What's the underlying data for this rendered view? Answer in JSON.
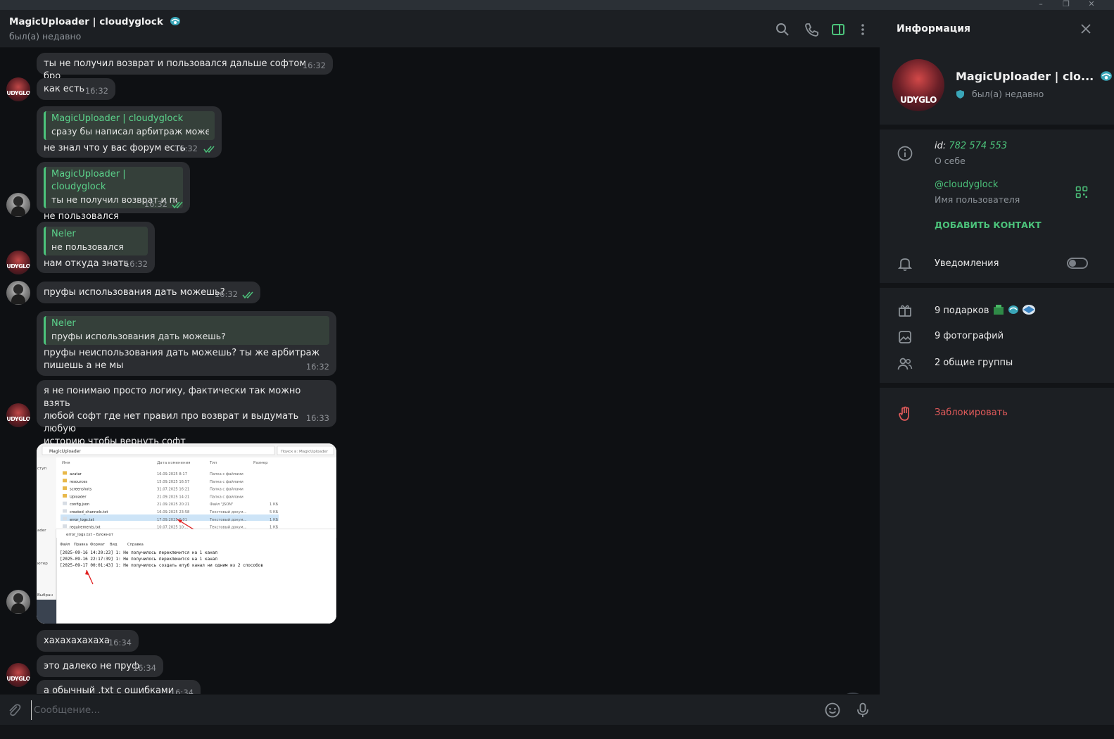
{
  "window": {
    "minimize": "–",
    "maximize": "❐",
    "close": "✕"
  },
  "chat": {
    "title": "MagicUploader | cloudyglock",
    "status": "был(а) недавно",
    "icons": [
      "search-icon",
      "phone-icon",
      "sidebar-toggle-icon",
      "more-vert-icon"
    ]
  },
  "messages": [
    {
      "text": "ты не получил возврат и пользовался дальше софтом бро",
      "time": "16:32"
    },
    {
      "text": "как есть",
      "time": "16:32"
    },
    {
      "reply_name": "MagicUploader | cloudyglock",
      "reply_text": "сразу бы написал арбитраж может...",
      "text": "не знал что у вас форум есть",
      "time": "16:32"
    },
    {
      "reply_name": "MagicUploader | cloudyglock",
      "reply_text": "ты не получил возврат и по...",
      "text": "не пользовался",
      "time": "16:32"
    },
    {
      "reply_name": "Neler",
      "reply_text": "не пользовался",
      "text": "нам откуда знать",
      "time": "16:32"
    },
    {
      "text": "пруфы использования дать можешь?",
      "time": "16:32"
    },
    {
      "reply_name": "Neler",
      "reply_text": "пруфы использования дать можешь?",
      "text_line1": "пруфы неиспользования дать можешь? ты же арбитраж",
      "text_line2": "пишешь а не мы",
      "time": "16:32"
    },
    {
      "text_line1": "я не понимаю просто логику, фактически так можно взять",
      "text_line2": "любой софт где нет правил про возврат и выдумать любую",
      "text_line3": "историю чтобы вернуть софт",
      "time": "16:33"
    },
    {
      "text": "хахахахахаха",
      "time": "16:34"
    },
    {
      "text": "это далеко не пруф",
      "time": "16:34"
    },
    {
      "text": "а обычный .txt с ошибками",
      "time": "16:34"
    }
  ],
  "avatars": {
    "glock_label": "UDYGLO"
  },
  "screenshot": {
    "path": "MagicUploader",
    "search": "Поиск в: MagicUploader",
    "columns": [
      "Имя",
      "Дата изменения",
      "Тип",
      "Размер"
    ],
    "sidebar_labels": [
      "ступ",
      "ader",
      "ютер",
      "Выбран"
    ],
    "files": [
      {
        "name": "avatar",
        "date": "16.09.2025 8:17",
        "type": "Папка с файлами",
        "size": ""
      },
      {
        "name": "resources",
        "date": "15.09.2025 16:57",
        "type": "Папка с файлами",
        "size": ""
      },
      {
        "name": "screenshots",
        "date": "31.07.2025 16:21",
        "type": "Папка с файлами",
        "size": ""
      },
      {
        "name": "Uploader",
        "date": "21.09.2025 14:21",
        "type": "Папка с файлами",
        "size": ""
      },
      {
        "name": "config.json",
        "date": "21.09.2025 20:21",
        "type": "Файл \"JSON\"",
        "size": "1 КБ"
      },
      {
        "name": "created_channels.txt",
        "date": "16.09.2025 23:58",
        "type": "Текстовый докум...",
        "size": "5 КБ"
      },
      {
        "name": "error_logs.txt",
        "date": "17.09.2025 0:01",
        "type": "Текстовый докум...",
        "size": "1 КБ"
      },
      {
        "name": "requirements.txt",
        "date": "10.07.2025 10:...",
        "type": "Текстовый докум...",
        "size": "1 КБ"
      }
    ],
    "notepad_title": "error_logs.txt – Блокнот",
    "notepad_menu": [
      "Файл",
      "Правка",
      "Формат",
      "Вид",
      "Справка"
    ],
    "log_lines": [
      "[2025-09-16 14:20:23] 1: Не получилось переключится на 1 канал",
      "[2025-09-16 22:17:39] 1: Не получилось переключится на 1 канал",
      "[2025-09-17 00:01:43] 1: Не получилось создать ютуб канал ни одним из 2 способов"
    ]
  },
  "composer": {
    "placeholder": "Сообщение..."
  },
  "info": {
    "title": "Информация",
    "name": "MagicUploader | clo...",
    "status": "был(а) недавно",
    "id_label": "id:",
    "id_value": "782 574 553",
    "about_label": "О себе",
    "username": "@cloudyglock",
    "username_label": "Имя пользователя",
    "add_contact": "ДОБАВИТЬ КОНТАКТ",
    "notifications": "Уведомления",
    "notifications_enabled": false,
    "gifts": "9 подарков",
    "photos": "9 фотографий",
    "groups": "2 общие группы",
    "block": "Заблокировать"
  },
  "colors": {
    "accent": "#4cc37b",
    "danger": "#e05a5a",
    "bubble": "#2b2d31",
    "panel": "#1c1f23"
  }
}
